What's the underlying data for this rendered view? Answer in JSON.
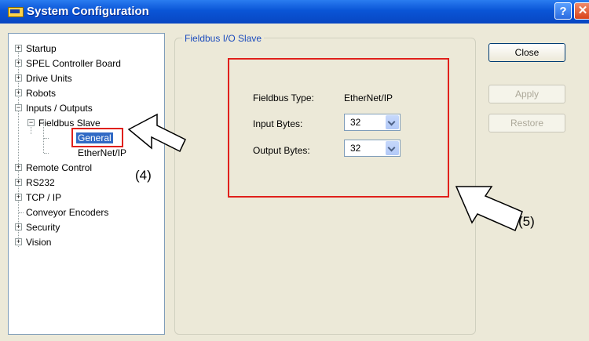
{
  "window": {
    "title": "System Configuration",
    "help_glyph": "?",
    "close_glyph": "✕"
  },
  "tree": {
    "items": [
      {
        "label": "Startup",
        "expander": "+"
      },
      {
        "label": "SPEL Controller Board",
        "expander": "+"
      },
      {
        "label": "Drive Units",
        "expander": "+"
      },
      {
        "label": "Robots",
        "expander": "+"
      },
      {
        "label": "Inputs / Outputs",
        "expander": "−"
      },
      {
        "label": "Fieldbus Slave",
        "expander": "−"
      },
      {
        "label": "General"
      },
      {
        "label": "EtherNet/IP"
      },
      {
        "label": "Remote Control",
        "expander": "+"
      },
      {
        "label": "RS232",
        "expander": "+"
      },
      {
        "label": "TCP / IP",
        "expander": "+"
      },
      {
        "label": "Conveyor Encoders"
      },
      {
        "label": "Security",
        "expander": "+"
      },
      {
        "label": "Vision",
        "expander": "+"
      }
    ]
  },
  "panel": {
    "group_title": "Fieldbus I/O Slave",
    "fieldbus_type_label": "Fieldbus Type:",
    "fieldbus_type_value": "EtherNet/IP",
    "input_bytes_label": "Input Bytes:",
    "input_bytes_value": "32",
    "output_bytes_label": "Output Bytes:",
    "output_bytes_value": "32"
  },
  "buttons": {
    "close": "Close",
    "apply": "Apply",
    "restore": "Restore"
  },
  "annotations": {
    "tree_callout": "(4)",
    "panel_callout": "(5)"
  },
  "colors": {
    "highlight_box": "#e0201b",
    "selection": "#316ac5",
    "title_bar": "#0a55d6"
  }
}
